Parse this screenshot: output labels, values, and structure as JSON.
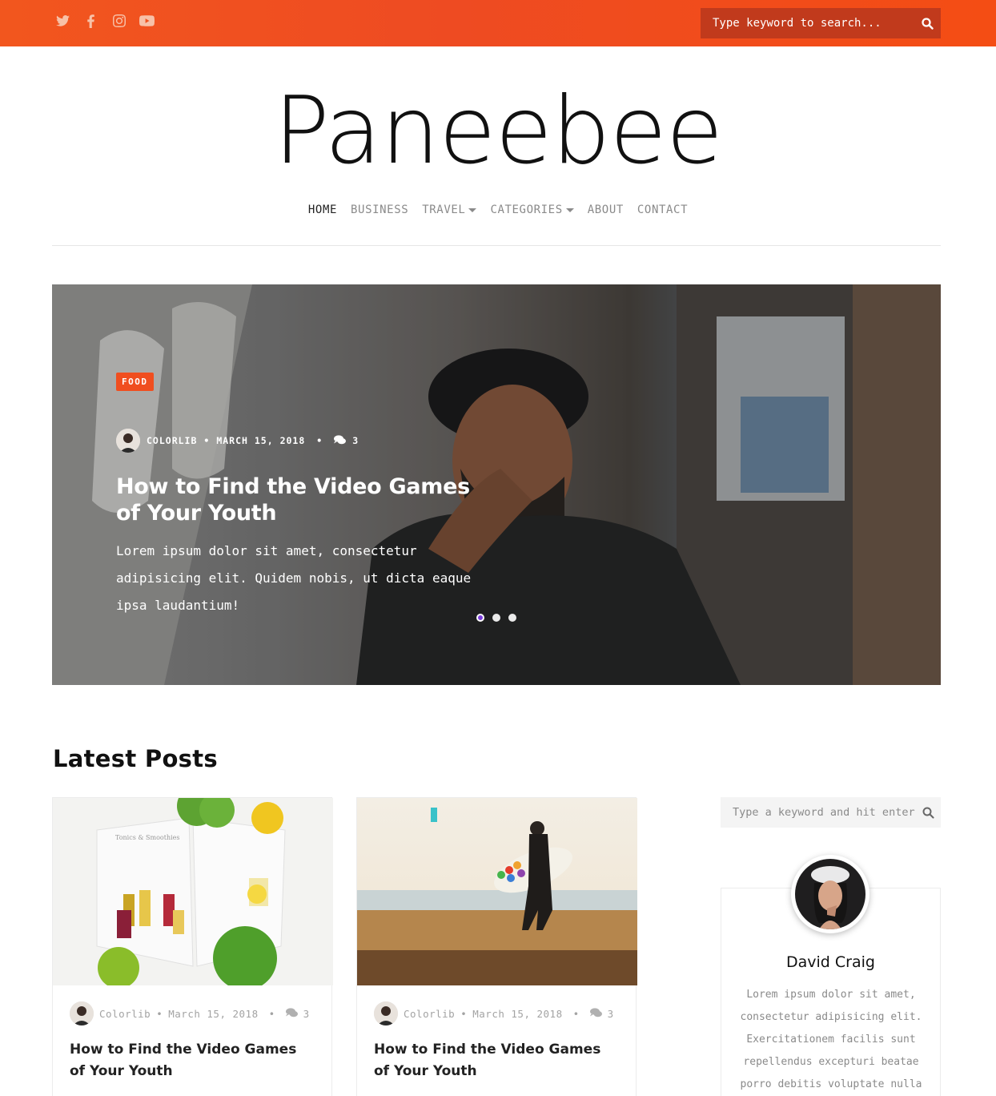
{
  "topbar": {
    "social_icons": [
      "twitter-icon",
      "facebook-icon",
      "instagram-icon",
      "youtube-icon"
    ],
    "search_placeholder": "Type keyword to search...",
    "accent_color": "#f04e1f"
  },
  "site": {
    "logo": "Paneebee"
  },
  "nav": {
    "items": [
      {
        "label": "HOME"
      },
      {
        "label": "BUSINESS"
      },
      {
        "label": "TRAVEL"
      },
      {
        "label": "CATEGORIES"
      },
      {
        "label": "ABOUT"
      },
      {
        "label": "CONTACT"
      }
    ]
  },
  "hero": {
    "category": "FOOD",
    "author": "COLORLIB",
    "separator": "•",
    "date": "MARCH 15, 2018",
    "comments": "3",
    "title": "How to Find the Video Games of Your Youth",
    "excerpt": "Lorem ipsum dolor sit amet, consectetur adipisicing elit. Quidem nobis, ut dicta eaque ipsa laudantium!",
    "slides_total": 3,
    "active_slide": 1
  },
  "latest": {
    "heading": "Latest Posts",
    "posts": [
      {
        "author": "Colorlib",
        "separator": "•",
        "date": "March 15, 2018",
        "comments": "3",
        "title": "How to Find the Video Games of Your Youth",
        "book_text": "Tonics & Smoothies"
      },
      {
        "author": "Colorlib",
        "separator": "•",
        "date": "March 15, 2018",
        "comments": "3",
        "title": "How to Find the Video Games of Your Youth"
      }
    ]
  },
  "sidebar": {
    "search_placeholder": "Type a keyword and hit enter",
    "bio": {
      "name": "David Craig",
      "text": "Lorem ipsum dolor sit amet, consectetur adipisicing elit. Exercitationem facilis sunt repellendus excepturi beatae porro debitis voluptate nulla"
    }
  }
}
